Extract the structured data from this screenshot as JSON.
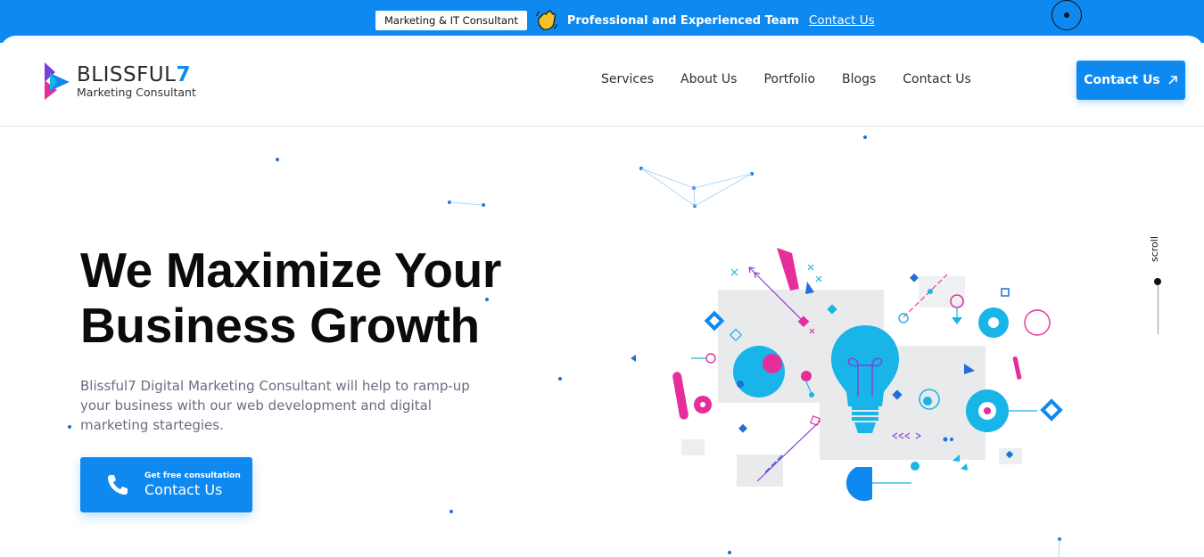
{
  "topbar": {
    "badge": "Marketing & IT Consultant",
    "tagline": "Professional and Experienced Team",
    "link": "Contact Us",
    "wave_icon": "waving-hand-icon"
  },
  "header": {
    "logo_name": "BLISSFUL",
    "logo_number": "7",
    "logo_sub": "Marketing Consultant",
    "nav": [
      "Services",
      "About Us",
      "Portfolio",
      "Blogs",
      "Contact Us"
    ],
    "cta": "Contact Us",
    "cta_icon": "arrow-up-right-icon"
  },
  "hero": {
    "title_line1": "We Maximize Your",
    "title_line2": "Business Growth",
    "description": "Blissful7 Digital Marketing Consultant will help to ramp-up your business with our web development and digital marketing startegies.",
    "button_small": "Get free consultation",
    "button_big": "Contact Us",
    "button_icon": "phone-icon"
  },
  "scroll": {
    "label": "scroll"
  },
  "colors": {
    "brand_blue": "#0e89f0",
    "accent_pink": "#e62e9a",
    "accent_cyan": "#19b4e8",
    "panel_gray": "#e9eaec"
  }
}
